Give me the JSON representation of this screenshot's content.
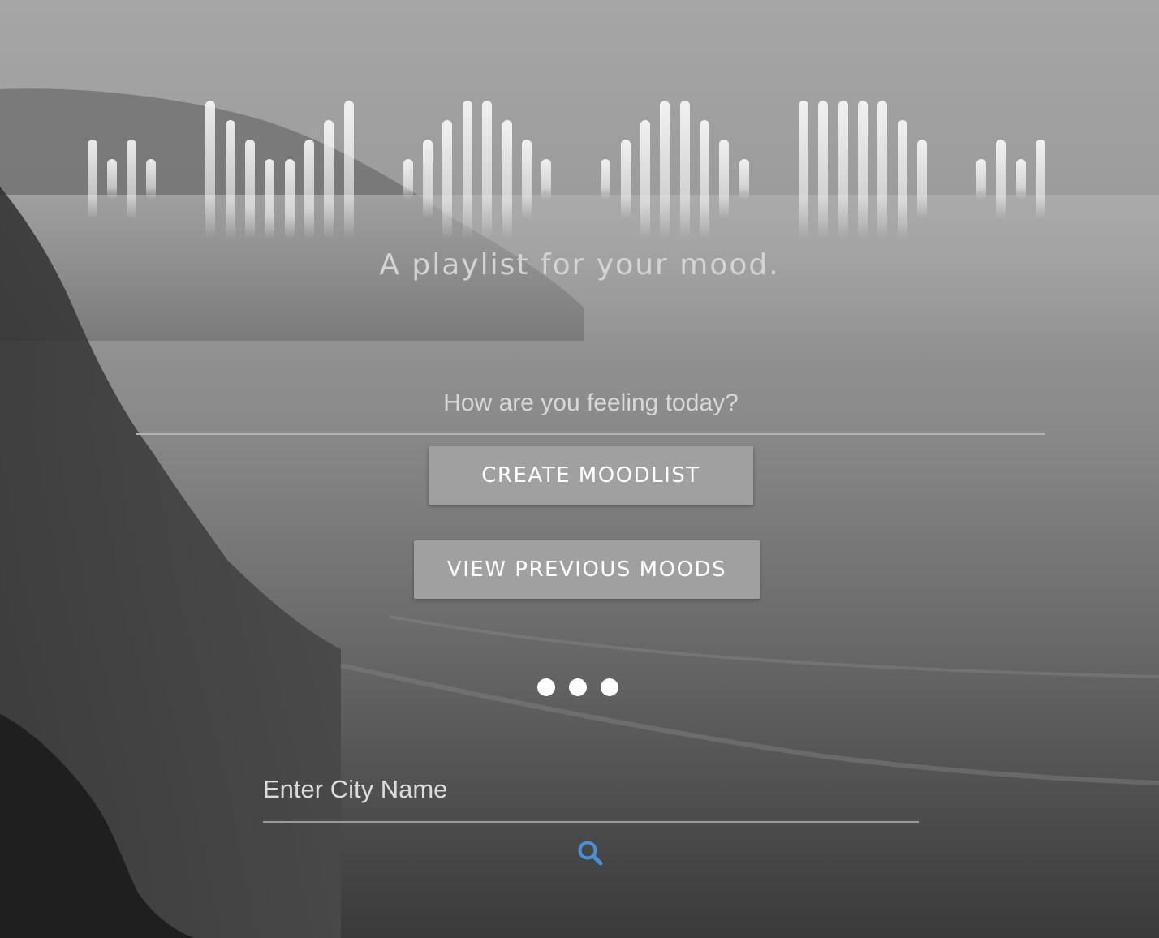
{
  "hero": {
    "tagline": "A playlist for your mood."
  },
  "mood_input": {
    "placeholder": "How are you feeling today?",
    "value": ""
  },
  "buttons": {
    "create_label": "CREATE MOODLIST",
    "view_label": "VIEW PREVIOUS MOODS"
  },
  "loading_indicator": {
    "dots": 3
  },
  "city_search": {
    "placeholder": "Enter City Name",
    "value": "",
    "icon": "search-icon",
    "icon_color": "#4a90d9"
  },
  "colors": {
    "button_bg": "#a0a0a0",
    "button_text": "#ffffff",
    "text_light": "#d8d8d8"
  }
}
